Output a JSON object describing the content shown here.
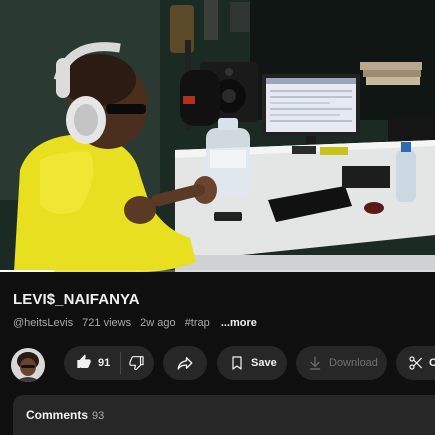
{
  "video": {
    "progress": 0.125
  },
  "title": "LEVI$_NAIFANYA",
  "meta": {
    "channel_handle": "@heitsLevis",
    "views": "721 views",
    "age": "2w ago",
    "hashtag": "#trap",
    "more_label": "...more"
  },
  "actions": {
    "like_count": "91",
    "save_label": "Save",
    "download_label": "Download",
    "clip_label": "C"
  },
  "comments": {
    "label": "Comments",
    "count": "93"
  },
  "icons": {
    "like": "thumbs-up-icon",
    "dislike": "thumbs-down-icon",
    "share": "share-arrow-icon",
    "save": "bookmark-icon",
    "download": "download-arrow-icon",
    "clip": "scissors-icon"
  },
  "colors": {
    "background": "#0f0f0f",
    "pill": "#272727",
    "text": "#f1f1f1",
    "secondary_text": "#aaaaaa",
    "disabled_text": "#717171",
    "progress": "#ffffff"
  }
}
